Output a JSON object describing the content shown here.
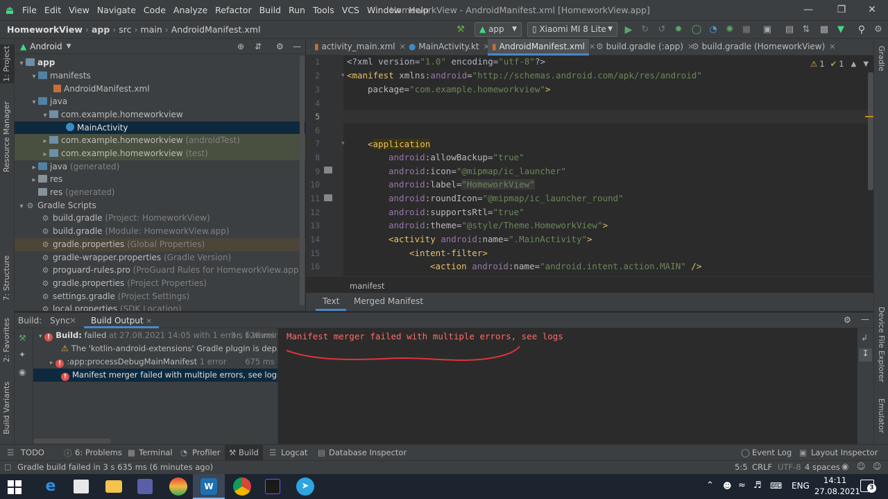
{
  "window": {
    "title": "HomeworkView - AndroidManifest.xml [HomeworkView.app]",
    "menus": [
      "File",
      "Edit",
      "View",
      "Navigate",
      "Code",
      "Analyze",
      "Refactor",
      "Build",
      "Run",
      "Tools",
      "VCS",
      "Window",
      "Help"
    ]
  },
  "breadcrumb": [
    "HomeworkView",
    "app",
    "src",
    "main",
    "AndroidManifest.xml"
  ],
  "toolbar": {
    "run_config": "app",
    "device": "Xiaomi MI 8 Lite"
  },
  "left_stripe": [
    "1: Project",
    "Resource Manager",
    "7: Structure",
    "2: Favorites",
    "Build Variants"
  ],
  "right_stripe": [
    "Gradle",
    "Device File Explorer",
    "Emulator"
  ],
  "project": {
    "view_mode": "Android",
    "tree": [
      {
        "label": "app",
        "extra": ""
      },
      {
        "label": "manifests",
        "extra": ""
      },
      {
        "label": "AndroidManifest.xml",
        "extra": ""
      },
      {
        "label": "java",
        "extra": ""
      },
      {
        "label": "com.example.homeworkview",
        "extra": ""
      },
      {
        "label": "MainActivity",
        "extra": ""
      },
      {
        "label": "com.example.homeworkview",
        "extra": "(androidTest)"
      },
      {
        "label": "com.example.homeworkview",
        "extra": "(test)"
      },
      {
        "label": "java",
        "extra": "(generated)"
      },
      {
        "label": "res",
        "extra": ""
      },
      {
        "label": "res",
        "extra": "(generated)"
      },
      {
        "label": "Gradle Scripts",
        "extra": ""
      },
      {
        "label": "build.gradle",
        "extra": "(Project: HomeworkView)"
      },
      {
        "label": "build.gradle",
        "extra": "(Module: HomeworkView.app)"
      },
      {
        "label": "gradle.properties",
        "extra": "(Global Properties)"
      },
      {
        "label": "gradle-wrapper.properties",
        "extra": "(Gradle Version)"
      },
      {
        "label": "proguard-rules.pro",
        "extra": "(ProGuard Rules for HomeworkView.app)"
      },
      {
        "label": "gradle.properties",
        "extra": "(Project Properties)"
      },
      {
        "label": "settings.gradle",
        "extra": "(Project Settings)"
      },
      {
        "label": "local.properties",
        "extra": "(SDK Location)"
      }
    ]
  },
  "editor": {
    "tabs": [
      "activity_main.xml",
      "MainActivity.kt",
      "AndroidManifest.xml",
      "build.gradle (:app)",
      "build.gradle (HomeworkView)"
    ],
    "active_tab": "AndroidManifest.xml",
    "inspection": {
      "warnings": "1",
      "weak": "1"
    },
    "line_numbers": [
      "1",
      "2",
      "3",
      "4",
      "5",
      "6",
      "7",
      "8",
      "9",
      "10",
      "11",
      "12",
      "13",
      "14",
      "15",
      "16"
    ],
    "code": {
      "l1_a": "<?xml version=",
      "l1_b": "\"1.0\"",
      "l1_c": " encoding=",
      "l1_d": "\"utf-8\"",
      "l1_e": "?>",
      "l2_tag": "<manifest",
      "l2_ns": " xmlns:",
      "l2_nsname": "android",
      "l2_eq": "=",
      "l2_val": "\"http://schemas.android.com/apk/res/android\"",
      "l3_attr": "package=",
      "l3_val": "\"com.example.homeworkview\"",
      "l3_end": ">",
      "l7_open": "<",
      "l7_tag": "application",
      "l8_ns": "android",
      "l8_attr": ":allowBackup=",
      "l8_val": "\"true\"",
      "l9_ns": "android",
      "l9_attr": ":icon=",
      "l9_val": "\"@mipmap/ic_launcher\"",
      "l10_ns": "android",
      "l10_attr": ":label=",
      "l10_val": "\"HomeworkView\"",
      "l11_ns": "android",
      "l11_attr": ":roundIcon=",
      "l11_val": "\"@mipmap/ic_launcher_round\"",
      "l12_ns": "android",
      "l12_attr": ":supportsRtl=",
      "l12_val": "\"true\"",
      "l13_ns": "android",
      "l13_attr": ":theme=",
      "l13_val": "\"@style/Theme.HomeworkView\"",
      "l13_end": ">",
      "l14_tag": "<activity",
      "l14_ns": " android",
      "l14_attr": ":name=",
      "l14_val": "\".MainActivity\"",
      "l14_end": ">",
      "l15_tag": "<intent-filter",
      "l15_end": ">",
      "l16_tag": "<action",
      "l16_ns": " android",
      "l16_attr": ":name=",
      "l16_val": "\"android.intent.action.MAIN\"",
      "l16_end": " />"
    },
    "breadcrumb": "manifest",
    "bottom_tabs": [
      "Text",
      "Merged Manifest"
    ]
  },
  "build": {
    "header_label": "Build:",
    "tabs": [
      "Sync",
      "Build Output"
    ],
    "rows": [
      {
        "main": "Build:",
        "rest": " failed",
        "detail": " at 27.08.2021 14:05 with 1 error, 1 warnir",
        "time": "3 s 628 ms"
      },
      {
        "main": "The 'kotlin-android-extensions' Gradle plugin is deprecated.",
        "rest": "",
        "detail": "",
        "time": ""
      },
      {
        "main": ":app:processDebugMainManifest",
        "rest": "",
        "detail": " 1 error",
        "time": "675 ms"
      },
      {
        "main": "Manifest merger failed with multiple errors, see logs",
        "rest": "",
        "detail": "",
        "time": ""
      }
    ],
    "output": "Manifest merger failed with multiple errors, see logs",
    "underline_color": "#e0343a"
  },
  "tool_strip": {
    "left": [
      "TODO",
      "6: Problems",
      "Terminal",
      "Profiler",
      "Build",
      "Logcat",
      "Database Inspector"
    ],
    "right": [
      "Event Log",
      "Layout Inspector"
    ]
  },
  "status": {
    "message": "Gradle build failed in 3 s 635 ms (6 minutes ago)",
    "position": "5:5",
    "line_sep": "CRLF",
    "encoding": "UTF-8",
    "indent": "4 spaces"
  },
  "taskbar": {
    "lang": "ENG",
    "time": "14:11",
    "date": "27.08.2021",
    "notifications": "3"
  }
}
